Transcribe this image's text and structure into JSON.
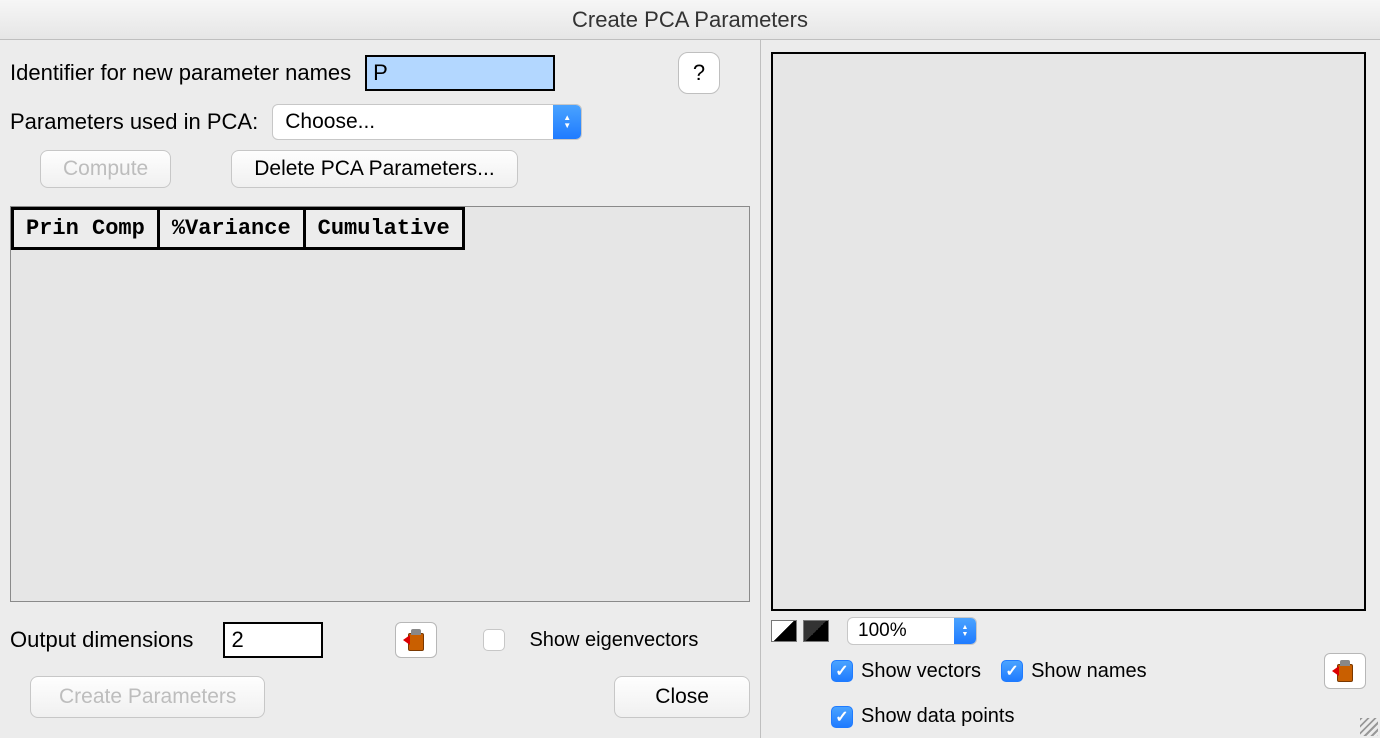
{
  "window": {
    "title": "Create PCA Parameters"
  },
  "left": {
    "identifier_label": "Identifier for new parameter names",
    "identifier_value": "P",
    "help_label": "?",
    "params_label": "Parameters used in PCA:",
    "params_select": "Choose...",
    "compute_label": "Compute",
    "delete_label": "Delete PCA Parameters...",
    "table_headers": [
      "Prin Comp",
      "%Variance",
      "Cumulative"
    ],
    "output_dim_label": "Output dimensions",
    "output_dim_value": "2",
    "show_eigen_label": "Show eigenvectors",
    "create_params_label": "Create Parameters",
    "close_label": "Close"
  },
  "right": {
    "zoom_value": "100%",
    "show_vectors_label": "Show vectors",
    "show_names_label": "Show names",
    "show_data_points_label": "Show data points"
  }
}
